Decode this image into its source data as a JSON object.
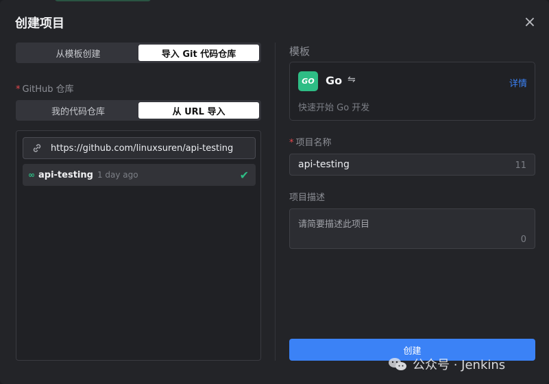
{
  "dialog": {
    "title": "创建项目",
    "close_glyph": "×"
  },
  "source_tabs": [
    {
      "label": "从模板创建",
      "active": false
    },
    {
      "label": "导入 Git 代码仓库",
      "active": true
    }
  ],
  "github": {
    "required_mark": "*",
    "label": "GitHub 仓库",
    "tabs": [
      {
        "label": "我的代码仓库",
        "active": false
      },
      {
        "label": "从 URL 导入",
        "active": true
      }
    ],
    "url_value": "https://github.com/linuxsuren/api-testing",
    "repo": {
      "name": "api-testing",
      "time": "1 day ago",
      "selected": true
    }
  },
  "template": {
    "section_label": "模板",
    "logo_text": "GO",
    "name": "Go",
    "swap_glyph": "⇋",
    "detail_link": "详情",
    "description": "快速开始 Go 开发"
  },
  "project_name": {
    "required_mark": "*",
    "label": "项目名称",
    "value": "api-testing",
    "count": "11"
  },
  "project_desc": {
    "label": "项目描述",
    "placeholder": "请简要描述此项目",
    "count": "0"
  },
  "submit_label": "创建",
  "watermark": "公众号 · Jenkins",
  "colors": {
    "accent": "#3b82f6",
    "success": "#2ebd85",
    "required": "#e5484d",
    "background": "#232428"
  }
}
